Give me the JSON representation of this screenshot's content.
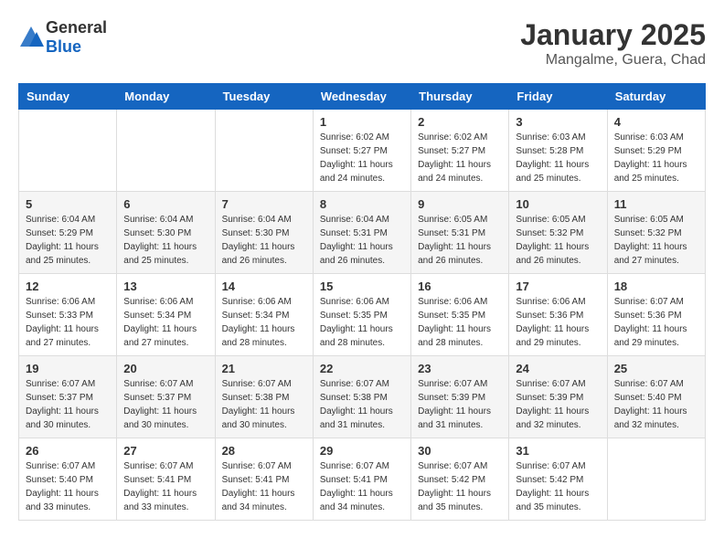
{
  "header": {
    "logo": {
      "general": "General",
      "blue": "Blue"
    },
    "title": "January 2025",
    "location": "Mangalme, Guera, Chad"
  },
  "days_of_week": [
    "Sunday",
    "Monday",
    "Tuesday",
    "Wednesday",
    "Thursday",
    "Friday",
    "Saturday"
  ],
  "weeks": [
    [
      {
        "day": "",
        "info": ""
      },
      {
        "day": "",
        "info": ""
      },
      {
        "day": "",
        "info": ""
      },
      {
        "day": "1",
        "info": "Sunrise: 6:02 AM\nSunset: 5:27 PM\nDaylight: 11 hours\nand 24 minutes."
      },
      {
        "day": "2",
        "info": "Sunrise: 6:02 AM\nSunset: 5:27 PM\nDaylight: 11 hours\nand 24 minutes."
      },
      {
        "day": "3",
        "info": "Sunrise: 6:03 AM\nSunset: 5:28 PM\nDaylight: 11 hours\nand 25 minutes."
      },
      {
        "day": "4",
        "info": "Sunrise: 6:03 AM\nSunset: 5:29 PM\nDaylight: 11 hours\nand 25 minutes."
      }
    ],
    [
      {
        "day": "5",
        "info": "Sunrise: 6:04 AM\nSunset: 5:29 PM\nDaylight: 11 hours\nand 25 minutes."
      },
      {
        "day": "6",
        "info": "Sunrise: 6:04 AM\nSunset: 5:30 PM\nDaylight: 11 hours\nand 25 minutes."
      },
      {
        "day": "7",
        "info": "Sunrise: 6:04 AM\nSunset: 5:30 PM\nDaylight: 11 hours\nand 26 minutes."
      },
      {
        "day": "8",
        "info": "Sunrise: 6:04 AM\nSunset: 5:31 PM\nDaylight: 11 hours\nand 26 minutes."
      },
      {
        "day": "9",
        "info": "Sunrise: 6:05 AM\nSunset: 5:31 PM\nDaylight: 11 hours\nand 26 minutes."
      },
      {
        "day": "10",
        "info": "Sunrise: 6:05 AM\nSunset: 5:32 PM\nDaylight: 11 hours\nand 26 minutes."
      },
      {
        "day": "11",
        "info": "Sunrise: 6:05 AM\nSunset: 5:32 PM\nDaylight: 11 hours\nand 27 minutes."
      }
    ],
    [
      {
        "day": "12",
        "info": "Sunrise: 6:06 AM\nSunset: 5:33 PM\nDaylight: 11 hours\nand 27 minutes."
      },
      {
        "day": "13",
        "info": "Sunrise: 6:06 AM\nSunset: 5:34 PM\nDaylight: 11 hours\nand 27 minutes."
      },
      {
        "day": "14",
        "info": "Sunrise: 6:06 AM\nSunset: 5:34 PM\nDaylight: 11 hours\nand 28 minutes."
      },
      {
        "day": "15",
        "info": "Sunrise: 6:06 AM\nSunset: 5:35 PM\nDaylight: 11 hours\nand 28 minutes."
      },
      {
        "day": "16",
        "info": "Sunrise: 6:06 AM\nSunset: 5:35 PM\nDaylight: 11 hours\nand 28 minutes."
      },
      {
        "day": "17",
        "info": "Sunrise: 6:06 AM\nSunset: 5:36 PM\nDaylight: 11 hours\nand 29 minutes."
      },
      {
        "day": "18",
        "info": "Sunrise: 6:07 AM\nSunset: 5:36 PM\nDaylight: 11 hours\nand 29 minutes."
      }
    ],
    [
      {
        "day": "19",
        "info": "Sunrise: 6:07 AM\nSunset: 5:37 PM\nDaylight: 11 hours\nand 30 minutes."
      },
      {
        "day": "20",
        "info": "Sunrise: 6:07 AM\nSunset: 5:37 PM\nDaylight: 11 hours\nand 30 minutes."
      },
      {
        "day": "21",
        "info": "Sunrise: 6:07 AM\nSunset: 5:38 PM\nDaylight: 11 hours\nand 30 minutes."
      },
      {
        "day": "22",
        "info": "Sunrise: 6:07 AM\nSunset: 5:38 PM\nDaylight: 11 hours\nand 31 minutes."
      },
      {
        "day": "23",
        "info": "Sunrise: 6:07 AM\nSunset: 5:39 PM\nDaylight: 11 hours\nand 31 minutes."
      },
      {
        "day": "24",
        "info": "Sunrise: 6:07 AM\nSunset: 5:39 PM\nDaylight: 11 hours\nand 32 minutes."
      },
      {
        "day": "25",
        "info": "Sunrise: 6:07 AM\nSunset: 5:40 PM\nDaylight: 11 hours\nand 32 minutes."
      }
    ],
    [
      {
        "day": "26",
        "info": "Sunrise: 6:07 AM\nSunset: 5:40 PM\nDaylight: 11 hours\nand 33 minutes."
      },
      {
        "day": "27",
        "info": "Sunrise: 6:07 AM\nSunset: 5:41 PM\nDaylight: 11 hours\nand 33 minutes."
      },
      {
        "day": "28",
        "info": "Sunrise: 6:07 AM\nSunset: 5:41 PM\nDaylight: 11 hours\nand 34 minutes."
      },
      {
        "day": "29",
        "info": "Sunrise: 6:07 AM\nSunset: 5:41 PM\nDaylight: 11 hours\nand 34 minutes."
      },
      {
        "day": "30",
        "info": "Sunrise: 6:07 AM\nSunset: 5:42 PM\nDaylight: 11 hours\nand 35 minutes."
      },
      {
        "day": "31",
        "info": "Sunrise: 6:07 AM\nSunset: 5:42 PM\nDaylight: 11 hours\nand 35 minutes."
      },
      {
        "day": "",
        "info": ""
      }
    ]
  ]
}
